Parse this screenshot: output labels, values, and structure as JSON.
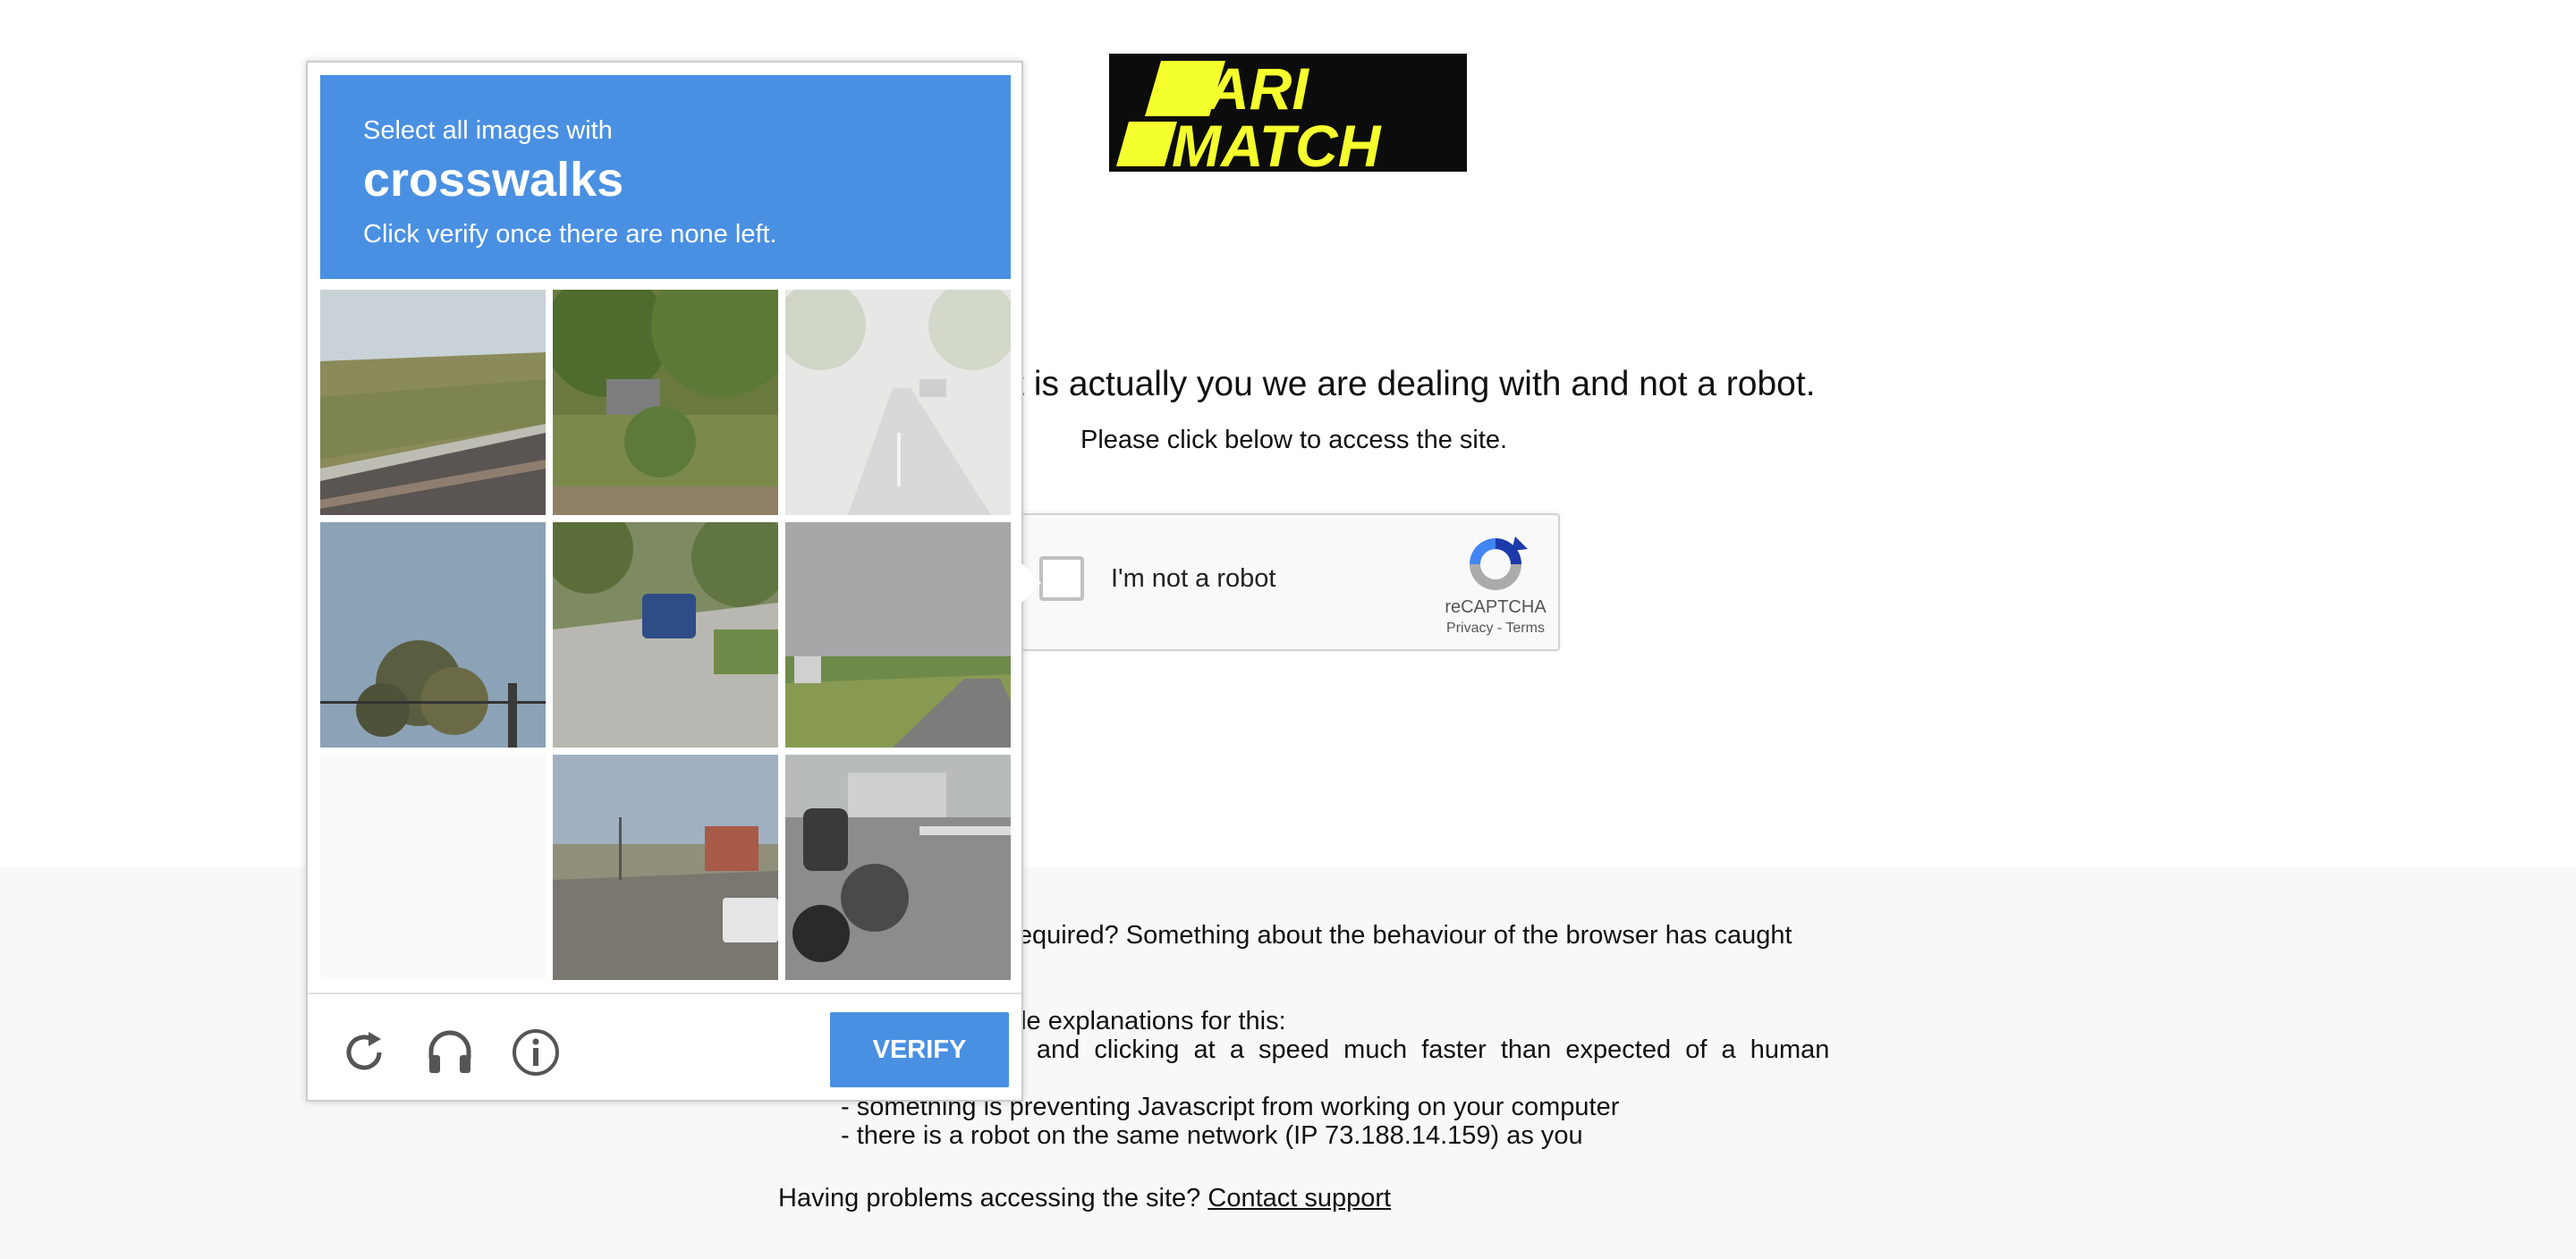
{
  "page": {
    "headline": "re it is actually you we are dealing with and not a robot.",
    "subline": "Please click below to access the site."
  },
  "logo": {
    "text_line1": "PARI",
    "text_line2": "MATCH",
    "bg_color": "#0c0c0c",
    "text_color": "#f5ff2d"
  },
  "recaptcha_anchor": {
    "label": "I'm not a robot",
    "brand": "reCAPTCHA",
    "privacy": "Privacy",
    "separator": " - ",
    "terms": "Terms",
    "icon": "recaptcha-logo-icon"
  },
  "explanation": {
    "line1": "n required? Something about the behaviour of the browser has caught",
    "line2": "sible explanations for this:",
    "line3": "ing  and  clicking  at  a  speed  much  faster  than  expected  of  a  human",
    "line4": "- something is preventing Javascript from working on your computer",
    "line5": "- there is a robot on the same network (IP 73.188.14.159) as you"
  },
  "support": {
    "prompt": "Having problems accessing the site?",
    "link": "Contact support"
  },
  "challenge": {
    "instruction": "Select all images with",
    "target": "crosswalks",
    "note": "Click verify once there are none left.",
    "header_color": "#4a90e2",
    "tiles": [
      {
        "scene": "grassy roadside with guardrail"
      },
      {
        "scene": "trees and shrubs with parked car"
      },
      {
        "scene": "faded street with road"
      },
      {
        "scene": "sky with treetop and traffic light"
      },
      {
        "scene": "blue car on residential road"
      },
      {
        "scene": "highway with grass median"
      },
      {
        "scene": "blank loading tile"
      },
      {
        "scene": "white pickup truck on street"
      },
      {
        "scene": "motorcycle at intersection"
      }
    ],
    "footer_icons": [
      "reload-icon",
      "headphones-icon",
      "info-icon"
    ],
    "verify_label": "VERIFY"
  }
}
